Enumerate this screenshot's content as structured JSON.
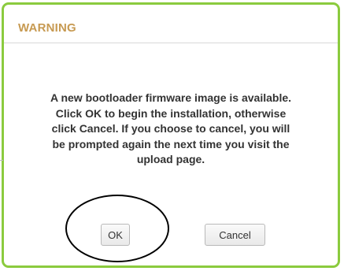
{
  "dialog": {
    "title": "WARNING",
    "message": "A new bootloader firmware image is available.\nClick OK to begin the installation, otherwise\nclick Cancel. If you choose to cancel, you will\nbe prompted again the next time you visit the\nupload page.",
    "ok_label": "OK",
    "cancel_label": "Cancel",
    "border_color": "#8bcb3e",
    "title_color": "#c79a52"
  },
  "annotation": {
    "shape": "ellipse",
    "target": "ok-button",
    "color": "#000000"
  }
}
